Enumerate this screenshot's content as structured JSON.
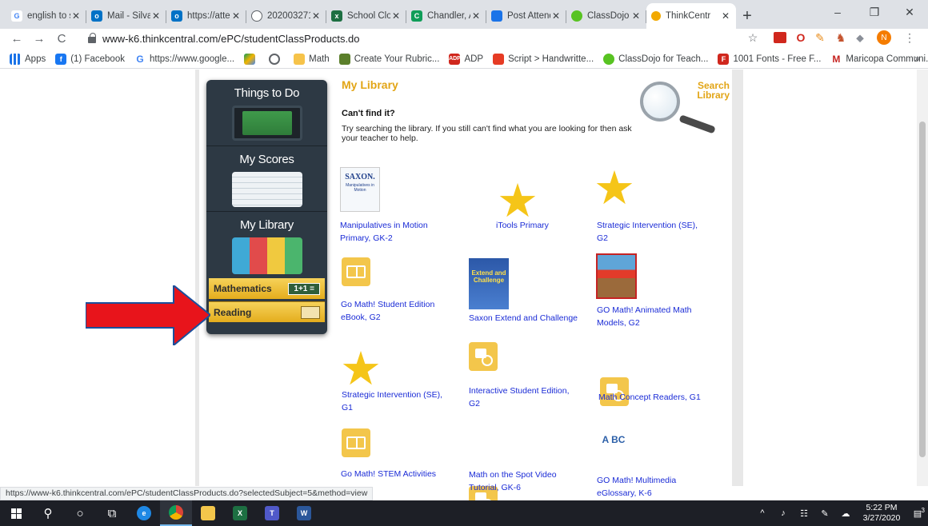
{
  "browser": {
    "tabs": [
      {
        "title": "english to s",
        "icon": "google",
        "color": "#4285f4",
        "letter": "G"
      },
      {
        "title": "Mail - Silva,",
        "icon": "outlook",
        "color": "#0072c6",
        "letter": "o"
      },
      {
        "title": "https://atte",
        "icon": "outlook",
        "color": "#0072c6",
        "letter": "o"
      },
      {
        "title": "202003271",
        "icon": "chrome-generic",
        "color": "#5f6368",
        "letter": ""
      },
      {
        "title": "School Clos",
        "icon": "excel",
        "color": "#1d6f42",
        "letter": "x"
      },
      {
        "title": "Chandler, A",
        "icon": "classroom",
        "color": "#0f9d58",
        "letter": "C"
      },
      {
        "title": "Post Attend",
        "icon": "meet",
        "color": "#1a73e8",
        "letter": ""
      },
      {
        "title": "ClassDojo f",
        "icon": "classdojo",
        "color": "#58c322",
        "letter": ""
      },
      {
        "title": "ThinkCentr",
        "icon": "thinkcentral",
        "color": "#f2a900",
        "letter": "",
        "active": true
      }
    ],
    "new_tab": "+",
    "window_controls": {
      "minimize": "–",
      "maximize": "❐",
      "close": "✕"
    },
    "url": "www-k6.thinkcentral.com/ePC/studentClassProducts.do",
    "nav": {
      "back": "←",
      "forward": "→",
      "reload": "C"
    },
    "profile_initial": "N",
    "bookmarks": [
      {
        "label": "Apps",
        "icon": "apps-grid-icon",
        "color": "#1a73e8"
      },
      {
        "label": "(1) Facebook",
        "icon": "facebook-icon",
        "color": "#1877f2"
      },
      {
        "label": "https://www.google...",
        "icon": "google-icon",
        "color": "#4285f4"
      },
      {
        "label": "",
        "icon": "drive-icon",
        "color": "#0f9d58"
      },
      {
        "label": "",
        "icon": "chrome-icon",
        "color": "#5f6368"
      },
      {
        "label": "Math",
        "icon": "folder-icon",
        "color": "#f6c34a"
      },
      {
        "label": "Create Your Rubric...",
        "icon": "rubric-icon",
        "color": "#5b7f2b"
      },
      {
        "label": "ADP",
        "icon": "adp-icon",
        "color": "#d0271d"
      },
      {
        "label": "Script > Handwritte...",
        "icon": "script-icon",
        "color": "#e63b24"
      },
      {
        "label": "ClassDojo for Teach...",
        "icon": "classdojo-icon",
        "color": "#58c322"
      },
      {
        "label": "1001 Fonts - Free F...",
        "icon": "fonts-icon",
        "color": "#d0271d"
      },
      {
        "label": "Maricopa Communi...",
        "icon": "gmail-icon",
        "color": "#c5221f"
      }
    ],
    "bookmarks_more": "»",
    "status_url": "https://www-k6.thinkcentral.com/ePC/studentClassProducts.do?selectedSubject=5&method=view"
  },
  "sidebar": {
    "sections": [
      {
        "title": "Things to Do"
      },
      {
        "title": "My Scores"
      },
      {
        "title": "My Library"
      }
    ],
    "subjects": [
      {
        "label": "Mathematics",
        "badge": "1+1 ="
      },
      {
        "label": "Reading",
        "badge": ""
      }
    ]
  },
  "library": {
    "title": "My Library",
    "search_label_line1": "Search",
    "search_label_line2": "Library",
    "cant_find": "Can't find it?",
    "description": "Try searching the library. If you still can't find what you are looking for then ask your teacher to help.",
    "products": [
      {
        "title": "Manipulatives in Motion Primary, GK-2",
        "icon": "saxon-cover"
      },
      {
        "title": "iTools Primary",
        "icon": "star"
      },
      {
        "title": "Strategic Intervention (SE), G2",
        "icon": "star"
      },
      {
        "title": "Go Math! Student Edition eBook, G2",
        "icon": "book"
      },
      {
        "title": "Saxon Extend and Challenge",
        "icon": "extend-cover"
      },
      {
        "title": "GO Math! Animated Math Models, G2",
        "icon": "curious-george"
      },
      {
        "title": "Strategic Intervention (SE), G1",
        "icon": "star"
      },
      {
        "title": "Interactive Student Edition, G2",
        "icon": "video"
      },
      {
        "title": "Math Concept Readers, G1",
        "icon": "video"
      },
      {
        "title": "Go Math! STEM Activities",
        "icon": "book"
      },
      {
        "title": "Math on the Spot Video Tutorial, GK-6",
        "icon": "video"
      },
      {
        "title": "GO Math! Multimedia eGlossary, K-6",
        "icon": "abc"
      }
    ],
    "saxon_text": "SAXON.",
    "saxon_sub": "Manipulatives in Motion",
    "extend_text": "Extend and Challenge",
    "abc_text": "A BC"
  },
  "taskbar": {
    "time": "5:22 PM",
    "date": "3/27/2020",
    "notification_count": "3"
  }
}
